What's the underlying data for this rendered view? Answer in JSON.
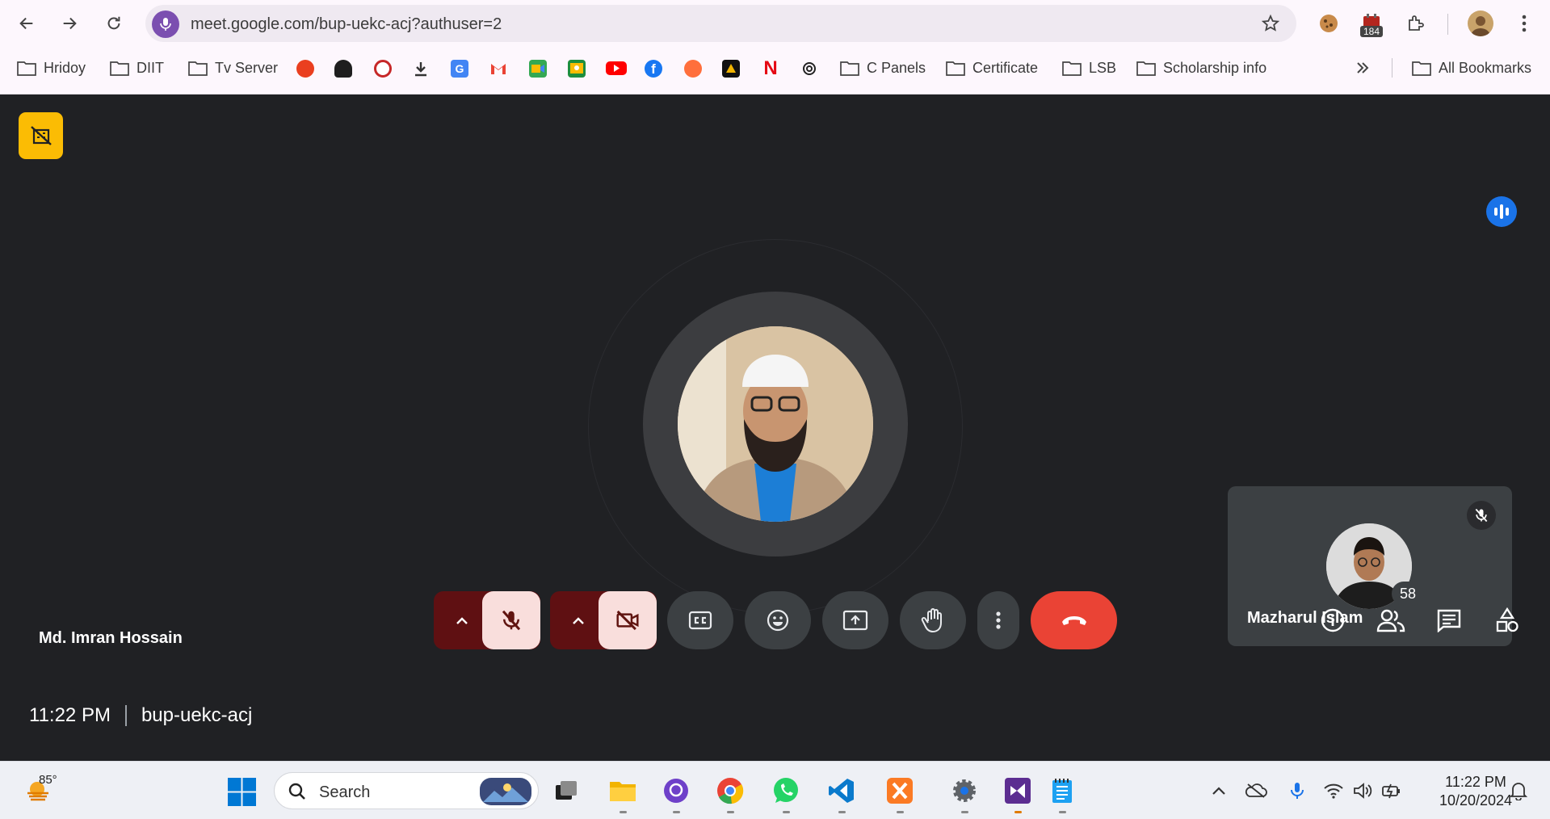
{
  "browser": {
    "url": "meet.google.com/bup-uekc-acj?authuser=2",
    "ext_badge": "184",
    "bookmarks": {
      "f1": "Hridoy",
      "f2": "DIIT",
      "f3": "Tv Server",
      "f4": "C Panels",
      "f5": "Certificate",
      "f6": "LSB",
      "f7": "Scholarship info",
      "all": "All Bookmarks"
    },
    "colors": {
      "accent": "#7b4fb0",
      "youtube": "#ff0000",
      "netflix": "#e50914"
    }
  },
  "meet": {
    "main_participant": "Md. Imran Hossain",
    "self_participant": "Mazharul Islam",
    "time": "11:22 PM",
    "meeting_code": "bup-uekc-acj",
    "people_count": "58",
    "colors": {
      "background": "#202124",
      "end_call": "#ea4335",
      "off_button": "#f9dedc",
      "badge": "#fbbc04",
      "speaking": "#1a73e8"
    }
  },
  "taskbar": {
    "temperature": "85°",
    "search_placeholder": "Search",
    "time": "11:22 PM",
    "date": "10/20/2024"
  }
}
